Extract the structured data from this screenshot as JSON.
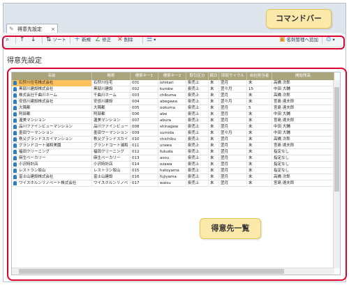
{
  "tab": {
    "title": "得意先設定",
    "close": "×"
  },
  "toolbar": {
    "sort_label": "ソート",
    "new_label": "新規",
    "edit_label": "修正",
    "delete_label": "削除",
    "name_manage_label": "名刺管理へ追加"
  },
  "page_title": "得意先設定",
  "callouts": {
    "command_bar": "コマンドバー",
    "customer_list": "得意先一覧"
  },
  "grid": {
    "columns": [
      "名前",
      "略称",
      "検索キー1",
      "検索キー2",
      "取引区分",
      "締日",
      "回収サイクル",
      "自社担当者",
      "開始残高"
    ],
    "rows": [
      [
        "石狩川住宅株式会社",
        "石狩川住宅",
        "001",
        "ishikari",
        "掛売上",
        "末",
        "翌月",
        "末",
        "高橋 次郎"
      ],
      [
        "黒部川建設株式会社",
        "黒部川建設",
        "002",
        "kurobe",
        "掛売上",
        "末",
        "翌々月",
        "15",
        "中田 大輔"
      ],
      [
        "株式会社千曲川ホーム",
        "千曲川ホーム",
        "003",
        "chikuma",
        "掛売上",
        "末",
        "翌月",
        "末",
        "高橋 次郎"
      ],
      [
        "安倍川建設株式会社",
        "安倍川建設",
        "004",
        "abegawa",
        "掛売上",
        "末",
        "翌々月",
        "末",
        "宮島 達夫郎"
      ],
      [
        "大隅都",
        "大隅都",
        "005",
        "ookuma",
        "掛売上",
        "末",
        "翌月",
        "5",
        "宮島 達夫郎"
      ],
      [
        "阿部都",
        "阿部都",
        "006",
        "abe",
        "掛売上",
        "末",
        "翌月",
        "末",
        "中田 大輔"
      ],
      [
        "渥美マンション",
        "渥美マンション",
        "007",
        "abura",
        "掛売上",
        "末",
        "翌月",
        "末",
        "宮島 達夫郎"
      ],
      [
        "品川ファインビューマンション",
        "品川ファインビュー",
        "008",
        "shinagaw",
        "掛売上",
        "末",
        "翌月",
        "末",
        "中田 大輔"
      ],
      [
        "墨田ウーマンション",
        "墨田ウーマンション",
        "009",
        "sumida",
        "掛売上",
        "末",
        "翌々月",
        "末",
        "中田 大輔"
      ],
      [
        "秩父グランドスカイマンション",
        "秩父グランドスカイ",
        "010",
        "chichibu",
        "掛売上",
        "末",
        "翌月",
        "末",
        "高橋 次郎"
      ],
      [
        "グランドコート浦和美園",
        "グランドコート浦和",
        "011",
        "urawa",
        "掛売上",
        "末",
        "翌月",
        "末",
        "宮島 達夫郎"
      ],
      [
        "福田クリーニング",
        "福田クリーニング",
        "012",
        "fukuda",
        "掛売上",
        "末",
        "翌月",
        "末",
        "指定なし"
      ],
      [
        "麻生ベーカリー",
        "麻生ベーカリー",
        "013",
        "asou",
        "掛売上",
        "末",
        "翌月",
        "末",
        "指定なし"
      ],
      [
        "小沢時計店",
        "小沢時計店",
        "014",
        "ozawa",
        "掛売上",
        "末",
        "翌月",
        "末",
        "指定なし"
      ],
      [
        "レストラン坂山",
        "レストラン坂山",
        "015",
        "hatoyama",
        "掛売上",
        "末",
        "翌月",
        "末",
        "指定なし"
      ],
      [
        "富士山建設株式会社",
        "富士山建設",
        "016",
        "fujiyama",
        "掛売上",
        "末",
        "翌月",
        "末",
        "高橋 次郎"
      ],
      [
        "ワイスホルンリノベート株式会社",
        "ワイスホルンリノベ",
        "017",
        "waisu",
        "掛売上",
        "末",
        "翌月",
        "末",
        "宮島 達夫郎"
      ]
    ]
  },
  "colors": {
    "accent_red": "#e0002c",
    "header_olive": "#a9a47c",
    "selected": "#ffc25e",
    "callout": "#fde9a9"
  }
}
